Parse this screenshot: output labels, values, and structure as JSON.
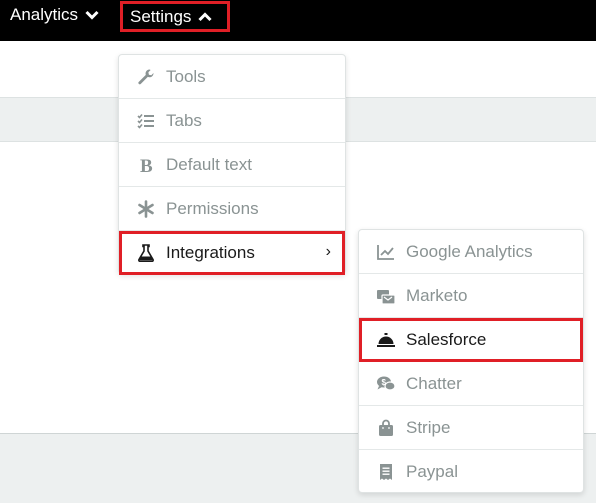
{
  "nav": {
    "analytics_label": "Analytics",
    "settings_label": "Settings"
  },
  "settings_menu": {
    "items": [
      {
        "label": "Tools",
        "icon": "wrench-icon"
      },
      {
        "label": "Tabs",
        "icon": "checklist-icon"
      },
      {
        "label": "Default text",
        "icon": "bold-icon"
      },
      {
        "label": "Permissions",
        "icon": "asterisk-icon"
      },
      {
        "label": "Integrations",
        "icon": "flask-icon",
        "submenu_indicator": "›"
      }
    ]
  },
  "integrations_menu": {
    "items": [
      {
        "label": "Google Analytics",
        "icon": "line-chart-icon"
      },
      {
        "label": "Marketo",
        "icon": "marketo-icon"
      },
      {
        "label": "Salesforce",
        "icon": "service-bell-icon"
      },
      {
        "label": "Chatter",
        "icon": "chat-bubbles-icon"
      },
      {
        "label": "Stripe",
        "icon": "shopping-bag-icon"
      },
      {
        "label": "Paypal",
        "icon": "receipt-icon"
      }
    ]
  },
  "colors": {
    "topbar": "#000000",
    "highlight": "#e01f26",
    "muted_text": "#8a9393",
    "dark_text": "#1a1a1a"
  }
}
